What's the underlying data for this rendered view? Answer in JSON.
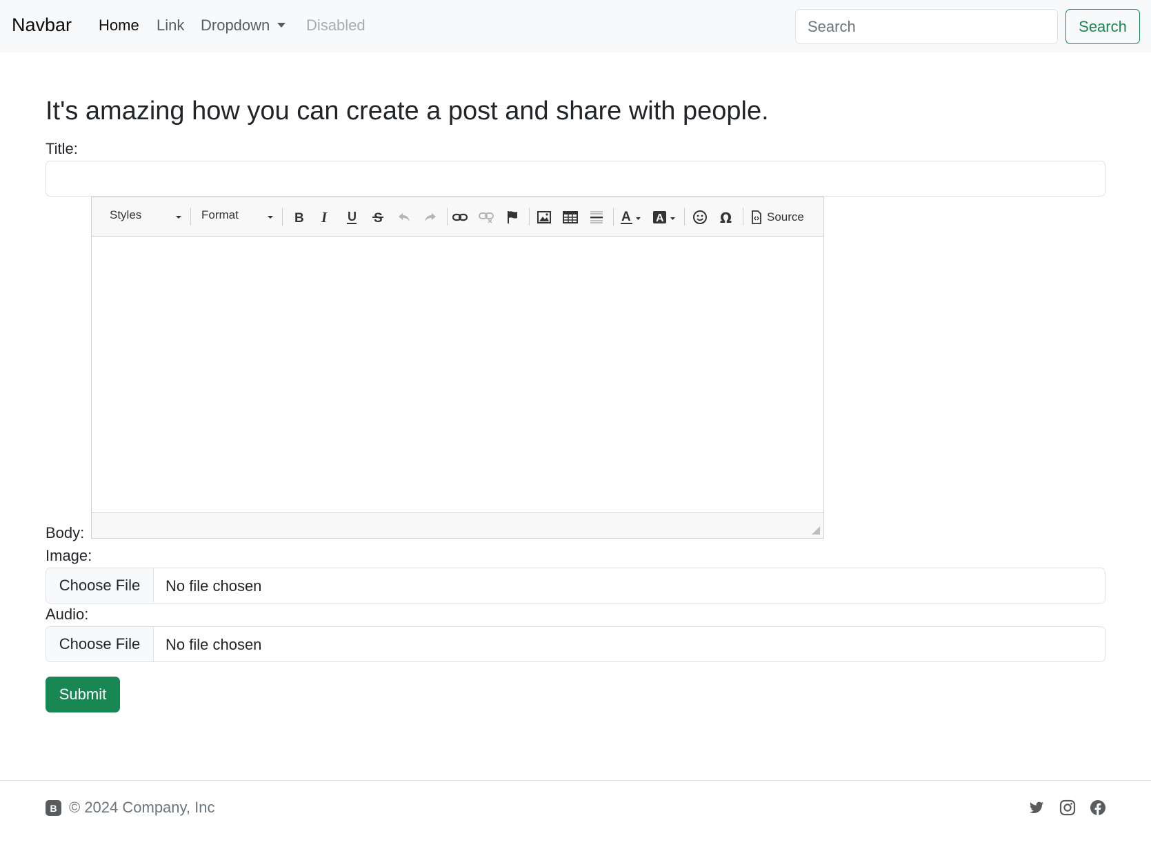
{
  "navbar": {
    "brand": "Navbar",
    "links": [
      {
        "label": "Home",
        "state": "active"
      },
      {
        "label": "Link",
        "state": "normal"
      },
      {
        "label": "Dropdown",
        "state": "dropdown"
      },
      {
        "label": "Disabled",
        "state": "disabled"
      }
    ],
    "search_placeholder": "Search",
    "search_button": "Search"
  },
  "main": {
    "heading": "It's amazing how you can create a post and share with people.",
    "title_label": "Title:",
    "title_value": "",
    "body_label": "Body:",
    "image_label": "Image:",
    "audio_label": "Audio:",
    "choose_file": "Choose File",
    "no_file": "No file chosen",
    "submit": "Submit"
  },
  "editor": {
    "styles_combo": "Styles",
    "format_combo": "Format",
    "tools": [
      "bold",
      "italic",
      "underline",
      "strikethrough",
      "undo",
      "redo",
      "link",
      "unlink",
      "anchor",
      "image",
      "table",
      "horizontal-rule",
      "text-color",
      "background-color",
      "smiley",
      "special-char"
    ],
    "source_label": "Source"
  },
  "footer": {
    "logo_letter": "B",
    "copyright": "© 2024 Company, Inc",
    "social": [
      "twitter",
      "instagram",
      "facebook"
    ]
  },
  "colors": {
    "accent": "#198754",
    "navbar_bg": "#f8f9fa",
    "muted": "#6c757d"
  }
}
